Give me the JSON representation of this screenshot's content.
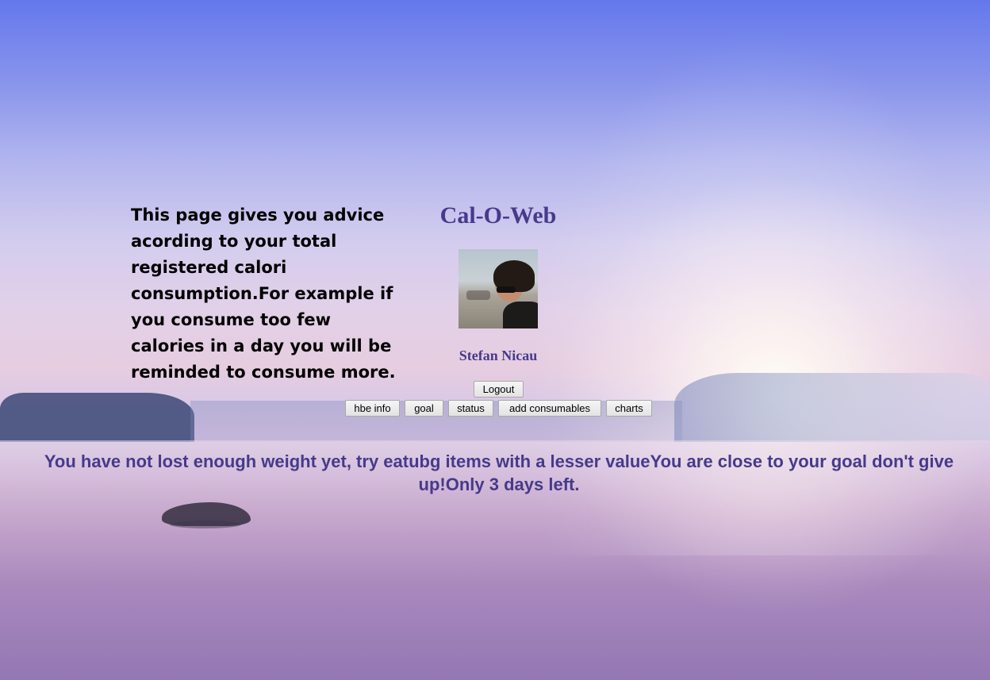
{
  "advice": {
    "text": "This page gives you advice acording to your total registered calori consumption.For example if you consume too few calories in a day you will be reminded to consume more."
  },
  "header": {
    "site_title": "Cal-O-Web",
    "user_name": "Stefan Nicau"
  },
  "account": {
    "logout_label": "Logout"
  },
  "nav": {
    "items": [
      {
        "label": "hbe info"
      },
      {
        "label": "goal"
      },
      {
        "label": "status"
      },
      {
        "label": "add consumables"
      },
      {
        "label": "charts"
      }
    ]
  },
  "status": {
    "message": "You have not lost enough weight yet, try eatubg items with a lesser valueYou are close to your goal don't give up!Only 3 days left."
  },
  "colors": {
    "accent_text": "#463a8a",
    "button_bg": "#e9e9e9"
  },
  "icons": {
    "avatar": "user-photo"
  }
}
